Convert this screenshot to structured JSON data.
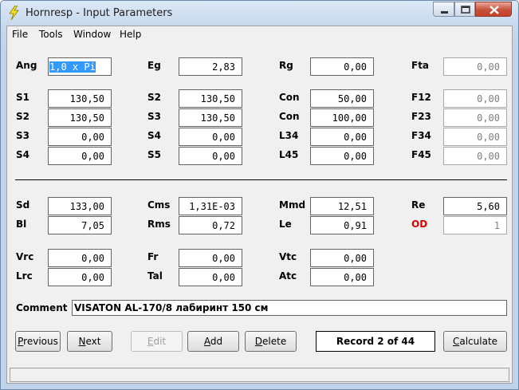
{
  "window": {
    "title": "Hornresp - Input Parameters"
  },
  "menu": [
    "File",
    "Tools",
    "Window",
    "Help"
  ],
  "colors": {
    "selection": "#3399ff",
    "od_label": "#e00000"
  },
  "rows": [
    [
      {
        "label": "Ang",
        "value": "1,0 x Pi",
        "selected": true
      },
      {
        "label": "Eg",
        "value": "2,83"
      },
      {
        "label": "Rg",
        "value": "0,00"
      },
      {
        "label": "Fta",
        "value": "0,00",
        "disabled": true
      }
    ],
    [
      {
        "label": "S1",
        "value": "130,50"
      },
      {
        "label": "S2",
        "value": "130,50"
      },
      {
        "label": "Con",
        "value": "50,00"
      },
      {
        "label": "F12",
        "value": "0,00",
        "disabled": true
      }
    ],
    [
      {
        "label": "S2",
        "value": "130,50"
      },
      {
        "label": "S3",
        "value": "130,50"
      },
      {
        "label": "Con",
        "value": "100,00"
      },
      {
        "label": "F23",
        "value": "0,00",
        "disabled": true
      }
    ],
    [
      {
        "label": "S3",
        "value": "0,00"
      },
      {
        "label": "S4",
        "value": "0,00"
      },
      {
        "label": "L34",
        "value": "0,00"
      },
      {
        "label": "F34",
        "value": "0,00",
        "disabled": true
      }
    ],
    [
      {
        "label": "S4",
        "value": "0,00"
      },
      {
        "label": "S5",
        "value": "0,00"
      },
      {
        "label": "L45",
        "value": "0,00"
      },
      {
        "label": "F45",
        "value": "0,00",
        "disabled": true
      }
    ],
    [
      {
        "label": "Sd",
        "value": "133,00"
      },
      {
        "label": "Cms",
        "value": "1,31E-03"
      },
      {
        "label": "Mmd",
        "value": "12,51"
      },
      {
        "label": "Re",
        "value": "5,60"
      }
    ],
    [
      {
        "label": "Bl",
        "value": "7,05"
      },
      {
        "label": "Rms",
        "value": "0,72"
      },
      {
        "label": "Le",
        "value": "0,91"
      },
      {
        "label": "OD",
        "value": "1",
        "disabled": true,
        "red": true
      }
    ],
    [
      {
        "label": "Vrc",
        "value": "0,00"
      },
      {
        "label": "Fr",
        "value": "0,00"
      },
      {
        "label": "Vtc",
        "value": "0,00"
      }
    ],
    [
      {
        "label": "Lrc",
        "value": "0,00"
      },
      {
        "label": "Tal",
        "value": "0,00"
      },
      {
        "label": "Atc",
        "value": "0,00"
      }
    ]
  ],
  "comment": {
    "label": "Comment",
    "value": "VISATON AL-170/8 лабиринт 150 см"
  },
  "buttons": {
    "previous": {
      "first": "P",
      "rest": "revious"
    },
    "next": {
      "first": "N",
      "rest": "ext"
    },
    "edit": {
      "first": "E",
      "rest": "dit"
    },
    "add": {
      "first": "A",
      "rest": "dd"
    },
    "delete": {
      "first": "D",
      "rest": "elete"
    },
    "calculate": {
      "first": "C",
      "rest": "alculate"
    }
  },
  "record": "Record 2 of 44",
  "status": ""
}
